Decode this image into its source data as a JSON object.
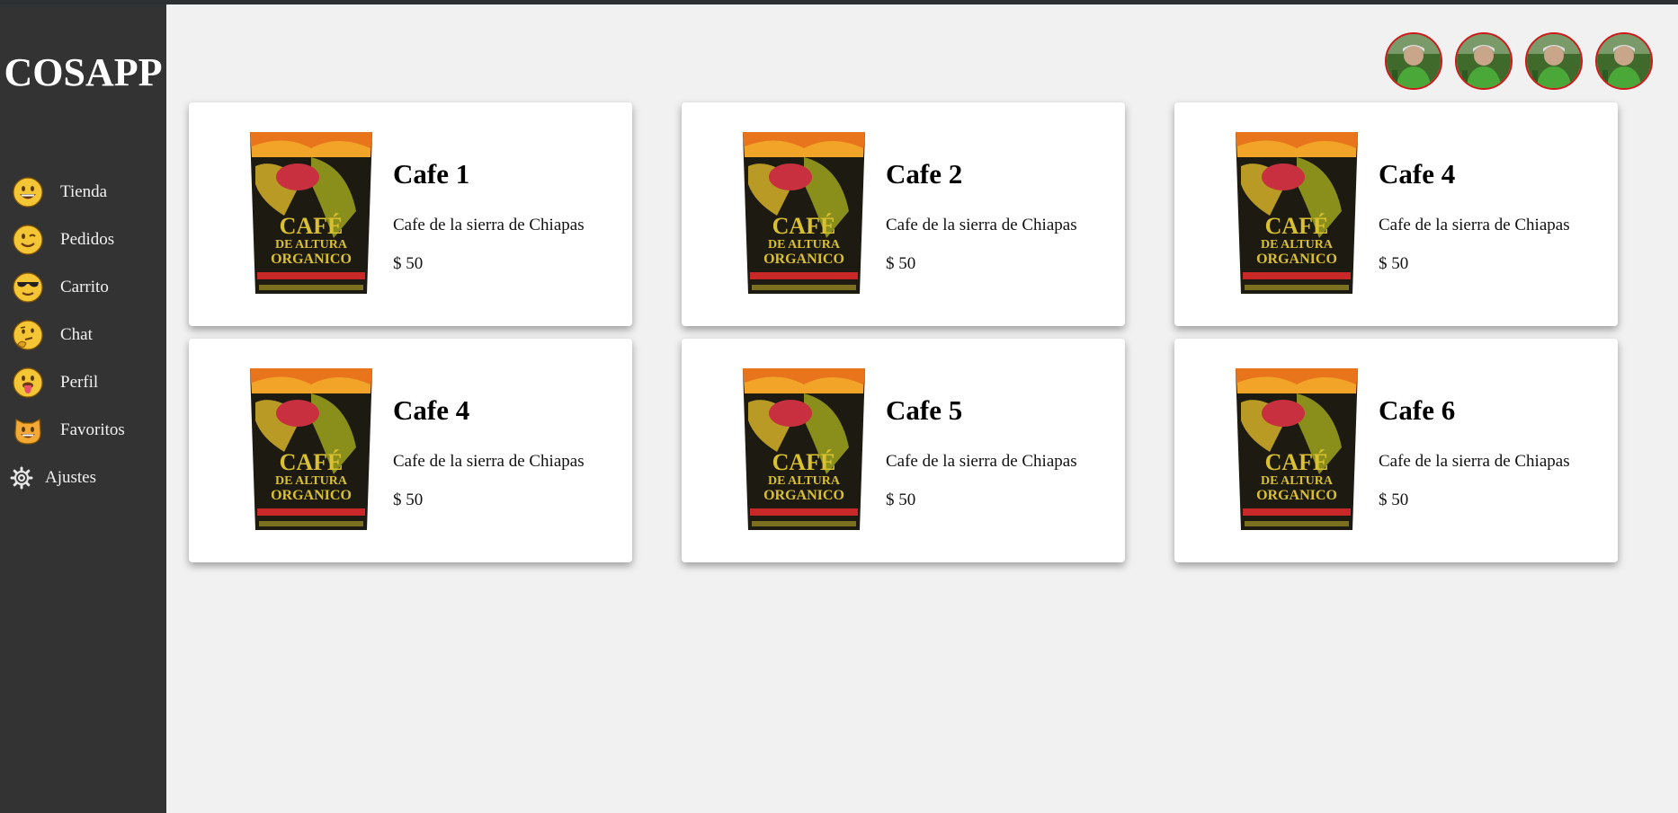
{
  "app": {
    "brand": "COSAPP"
  },
  "sidebar": {
    "items": [
      {
        "label": "Tienda",
        "icon": "grinning-face-icon"
      },
      {
        "label": "Pedidos",
        "icon": "winking-face-icon"
      },
      {
        "label": "Carrito",
        "icon": "sunglasses-face-icon"
      },
      {
        "label": "Chat",
        "icon": "thinking-face-icon"
      },
      {
        "label": "Perfil",
        "icon": "tongue-face-icon"
      },
      {
        "label": "Favoritos",
        "icon": "grinning-cat-icon"
      },
      {
        "label": "Ajustes",
        "icon": "gear-icon"
      }
    ]
  },
  "header": {
    "avatars": [
      "user-avatar",
      "user-avatar",
      "user-avatar",
      "user-avatar"
    ]
  },
  "products": [
    {
      "name": "Cafe 1",
      "description": "Cafe de la sierra de Chiapas",
      "price": "$ 50"
    },
    {
      "name": "Cafe 2",
      "description": "Cafe de la sierra de Chiapas",
      "price": "$ 50"
    },
    {
      "name": "Cafe 4",
      "description": "Cafe de la sierra de Chiapas",
      "price": "$ 50"
    },
    {
      "name": "Cafe 4",
      "description": "Cafe de la sierra de Chiapas",
      "price": "$ 50"
    },
    {
      "name": "Cafe 5",
      "description": "Cafe de la sierra de Chiapas",
      "price": "$ 50"
    },
    {
      "name": "Cafe 6",
      "description": "Cafe de la sierra de Chiapas",
      "price": "$ 50"
    }
  ],
  "colors": {
    "sidebar_bg": "#333333",
    "page_bg": "#f1f1f1",
    "card_bg": "#ffffff",
    "avatar_border": "#d01818",
    "emoji_yellow": "#f4c534"
  }
}
